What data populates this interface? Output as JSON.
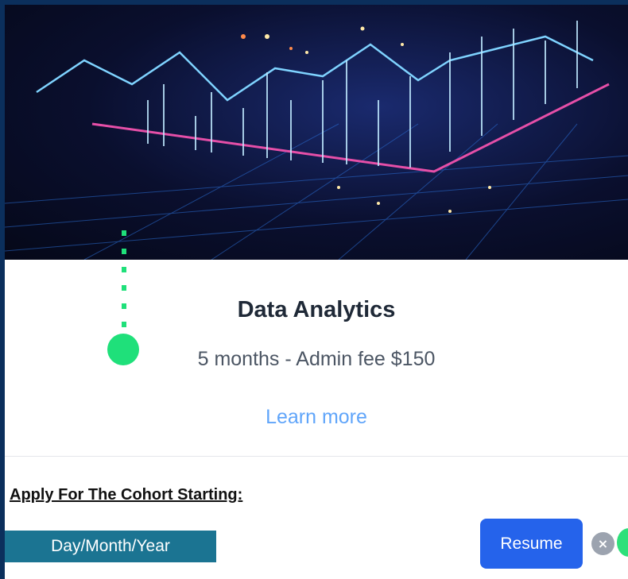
{
  "course": {
    "title": "Data Analytics",
    "subtitle": "5 months - Admin fee $150",
    "learn_more": "Learn more"
  },
  "apply": {
    "label": "Apply For The Cohort Starting:",
    "date_placeholder": "Day/Month/Year",
    "resume_label": "Resume",
    "close_symbol": "×"
  },
  "colors": {
    "page_background": "#0b2f5c",
    "resume_button": "#2563eb",
    "date_box": "#1b7492",
    "link": "#60a5fa",
    "tour_marker": "#1fe07a"
  }
}
